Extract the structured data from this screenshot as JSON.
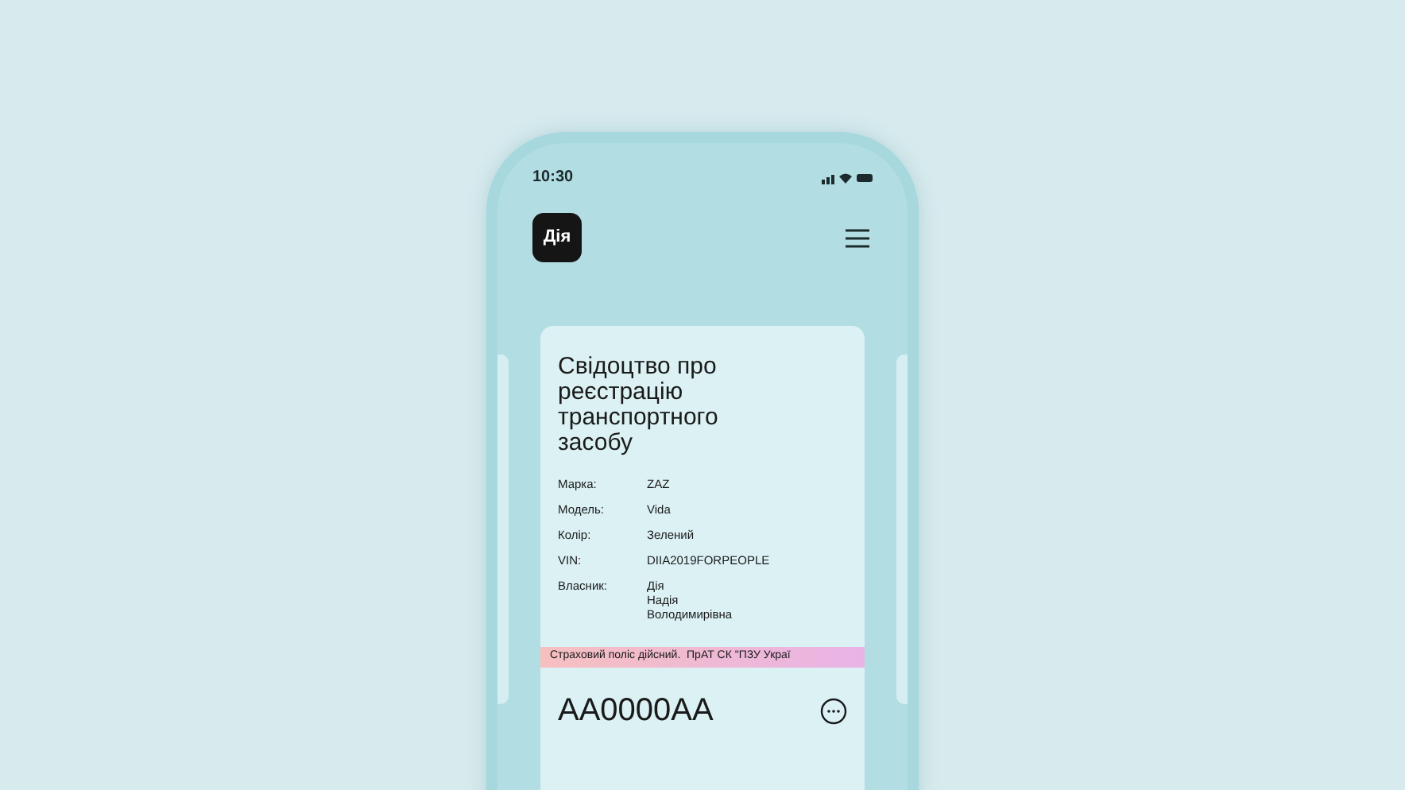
{
  "status_bar": {
    "time": "10:30"
  },
  "header": {
    "logo": "Дія"
  },
  "document": {
    "title": "Свідоцтво про реєстрацію транспортного засобу",
    "fields": [
      {
        "label": "Марка:",
        "value": "ZAZ"
      },
      {
        "label": "Модель:",
        "value": "Vida"
      },
      {
        "label": "Колір:",
        "value": "Зелений"
      },
      {
        "label": "VIN:",
        "value": "DIIA2019FORPEOPLE"
      },
      {
        "label": "Власник:",
        "value": "Дія\nНадія\nВолодимирівна"
      }
    ],
    "ticker": "Страховий поліс дійсний.  ПрАТ СК \"ПЗУ Украї",
    "plate": "AA0000AA"
  }
}
